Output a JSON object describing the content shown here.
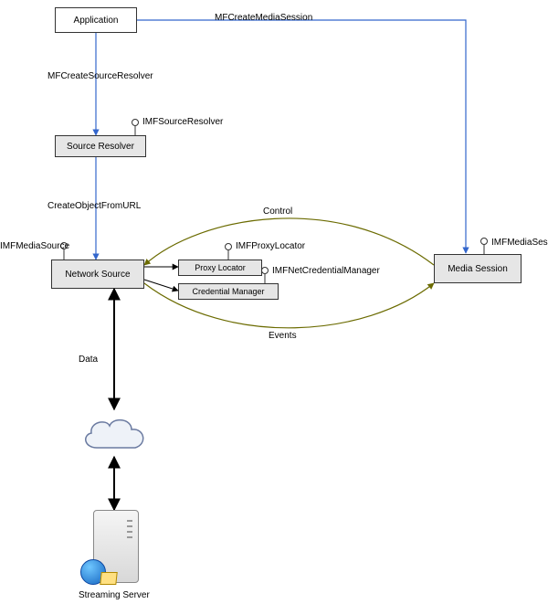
{
  "nodes": {
    "application": "Application",
    "source_resolver": "Source Resolver",
    "network_source": "Network Source",
    "proxy_locator": "Proxy Locator",
    "credential_manager": "Credential Manager",
    "media_session": "Media Session",
    "streaming_server": "Streaming Server"
  },
  "edges": {
    "mf_create_media_session": "MFCreateMediaSession",
    "mf_create_source_resolver": "MFCreateSourceResolver",
    "create_object_from_url": "CreateObjectFromURL",
    "control": "Control",
    "events": "Events",
    "data": "Data"
  },
  "interfaces": {
    "imf_source_resolver": "IMFSourceResolver",
    "imf_media_source": "IMFMediaSource",
    "imf_proxy_locator": "IMFProxyLocator",
    "imf_net_credential_manager": "IMFNetCredentialManager",
    "imf_media_session": "IMFMediaSession"
  },
  "colors": {
    "blue_arrow": "#3366cc",
    "olive_arrow": "#6b6b00",
    "black_arrow": "#000000"
  }
}
